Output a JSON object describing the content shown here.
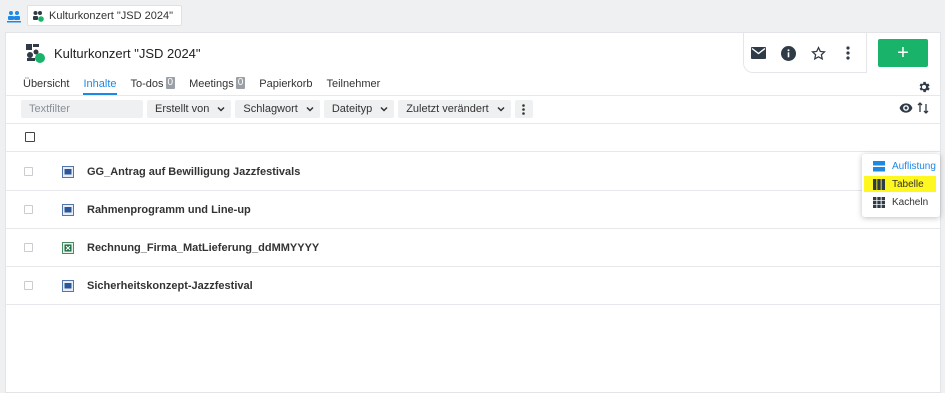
{
  "breadcrumb": {
    "home_icon": "rooms-icon",
    "room_tab_label": "Kulturkonzert \"JSD 2024\""
  },
  "header": {
    "title": "Kulturkonzert \"JSD 2024\"",
    "actions": [
      "mail-icon",
      "info-icon",
      "star-icon",
      "more-vertical-icon"
    ],
    "add_label": "+",
    "accent_color": "#19b46a"
  },
  "tabs": [
    {
      "label": "Übersicht",
      "active": false,
      "badge": null
    },
    {
      "label": "Inhalte",
      "active": true,
      "badge": null
    },
    {
      "label": "To-dos",
      "active": false,
      "badge": "0"
    },
    {
      "label": "Meetings",
      "active": false,
      "badge": "0"
    },
    {
      "label": "Papierkorb",
      "active": false,
      "badge": null
    },
    {
      "label": "Teilnehmer",
      "active": false,
      "badge": null
    }
  ],
  "filters": {
    "text_placeholder": "Textfilter",
    "created_by": "Erstellt von",
    "keyword": "Schlagwort",
    "file_type": "Dateityp",
    "last_modified": "Zuletzt verändert"
  },
  "files": [
    {
      "name": "GG_Antrag auf Bewilligung Jazzfestivals",
      "type": "word",
      "icon": "word-document-icon"
    },
    {
      "name": "Rahmenprogramm und Line-up",
      "type": "word",
      "icon": "word-document-icon"
    },
    {
      "name": "Rechnung_Firma_MatLieferung_ddMMYYYY",
      "type": "excel",
      "icon": "excel-document-icon"
    },
    {
      "name": "Sicherheitskonzept-Jazzfestival",
      "type": "word",
      "icon": "word-document-icon"
    }
  ],
  "view_menu": {
    "items": [
      {
        "label": "Auflistung",
        "icon": "list-view-icon",
        "selected": true
      },
      {
        "label": "Tabelle",
        "icon": "table-view-icon",
        "highlighted": true
      },
      {
        "label": "Kacheln",
        "icon": "tiles-view-icon"
      }
    ],
    "highlight_color": "#fff720",
    "accent_color": "#1e88e5"
  }
}
